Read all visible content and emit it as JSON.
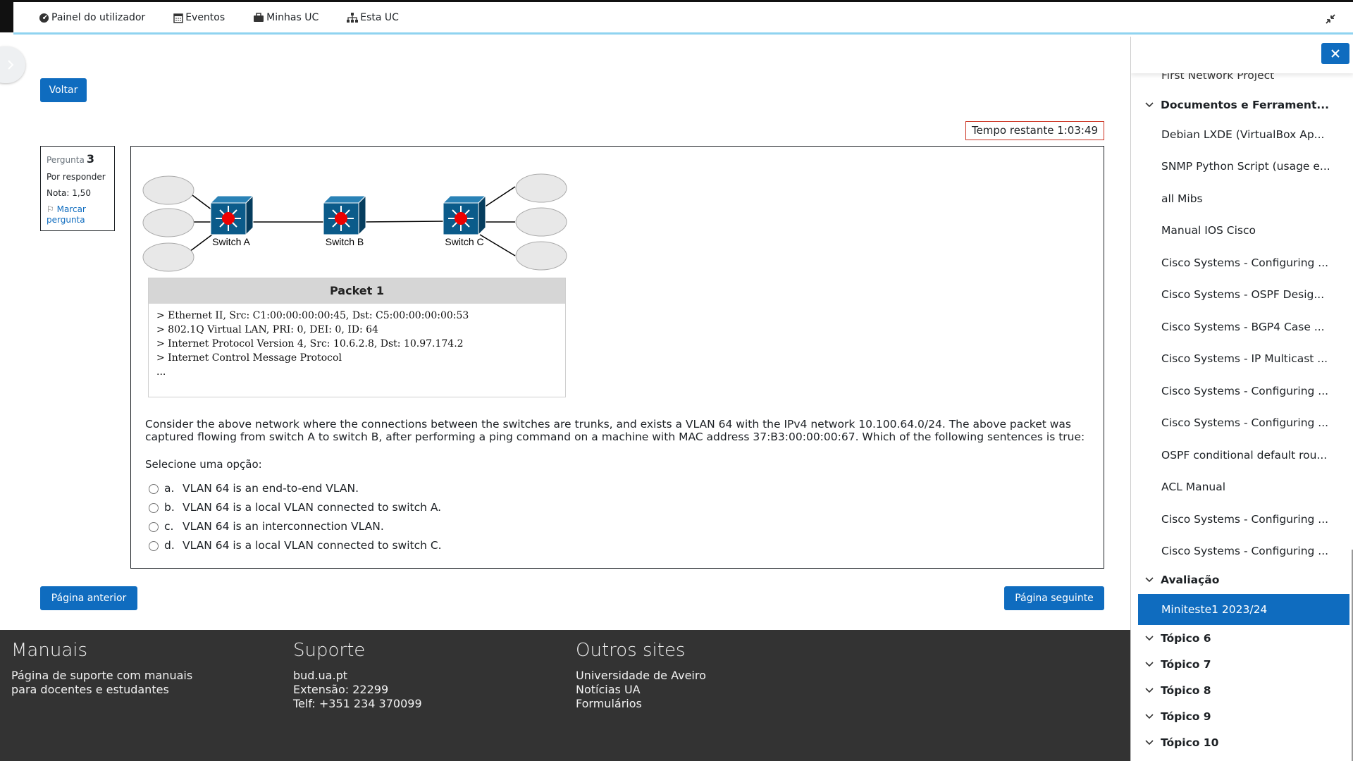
{
  "nav": {
    "dashboard": "Painel do utilizador",
    "events": "Eventos",
    "my_courses": "Minhas UC",
    "this_course": "Esta UC"
  },
  "back_button": "Voltar",
  "timer": "Tempo restante 1:03:49",
  "question_info": {
    "label": "Pergunta",
    "number": "3",
    "state": "Por responder",
    "grade": "Nota: 1,50",
    "flag": "Marcar pergunta"
  },
  "diagram": {
    "switches": [
      "Switch A",
      "Switch B",
      "Switch C"
    ]
  },
  "packet": {
    "title": "Packet 1",
    "lines": [
      "> Ethernet II, Src: C1:00:00:00:00:45, Dst: C5:00:00:00:00:53",
      "> 802.1Q Virtual LAN, PRI: 0, DEI: 0, ID: 64",
      "> Internet Protocol Version 4, Src: 10.6.2.8, Dst: 10.97.174.2",
      "> Internet Control Message Protocol",
      "..."
    ]
  },
  "question_text": "Consider the above network where the connections between the switches are trunks, and exists a VLAN 64 with the IPv4 network 10.100.64.0/24. The above packet was captured flowing from switch A to switch B, after performing a ping command on a machine with MAC address 37:B3:00:00:00:67. Which of the following sentences is true:",
  "prompt": "Selecione uma opção:",
  "options": [
    {
      "letter": "a.",
      "text": "VLAN 64 is an end-to-end VLAN."
    },
    {
      "letter": "b.",
      "text": "VLAN 64 is a local VLAN connected to switch A."
    },
    {
      "letter": "c.",
      "text": "VLAN 64 is an interconnection VLAN."
    },
    {
      "letter": "d.",
      "text": "VLAN 64 is a local VLAN connected to switch C."
    }
  ],
  "prev_button": "Página anterior",
  "next_button": "Página seguinte",
  "footer": {
    "manuals": {
      "title": "Manuais",
      "line1": "Página de suporte com manuais",
      "line2": "para docentes e estudantes"
    },
    "support": {
      "title": "Suporte",
      "line1": "bud.ua.pt",
      "line2": "Extensão: 22299",
      "line3": "Telf: +351 234 370099"
    },
    "other": {
      "title": "Outros sites",
      "line1": "Universidade de Aveiro",
      "line2": "Notícias UA",
      "line3": "Formulários"
    }
  },
  "drawer": {
    "partial_item": "First Network Project",
    "section_docs": "Documentos e Ferrament...",
    "items": [
      "Debian LXDE (VirtualBox Ap...",
      "SNMP Python Script (usage e...",
      "all Mibs",
      "Manual IOS Cisco",
      "Cisco Systems - Configuring ...",
      "Cisco Systems - OSPF Desig...",
      "Cisco Systems - BGP4 Case ...",
      "Cisco Systems - IP Multicast ...",
      "Cisco Systems - Configuring ...",
      "Cisco Systems - Configuring ...",
      "OSPF conditional default rou...",
      "ACL Manual",
      "Cisco Systems - Configuring ...",
      "Cisco Systems - Configuring ..."
    ],
    "section_eval": "Avaliação",
    "active_item": "Miniteste1 2023/24",
    "topics": [
      "Tópico 6",
      "Tópico 7",
      "Tópico 8",
      "Tópico 9",
      "Tópico 10"
    ]
  },
  "colors": {
    "primary": "#0f6cbf",
    "footer": "#333333",
    "timer_border": "#ca3120",
    "top_accent": "#8fd3f0"
  }
}
